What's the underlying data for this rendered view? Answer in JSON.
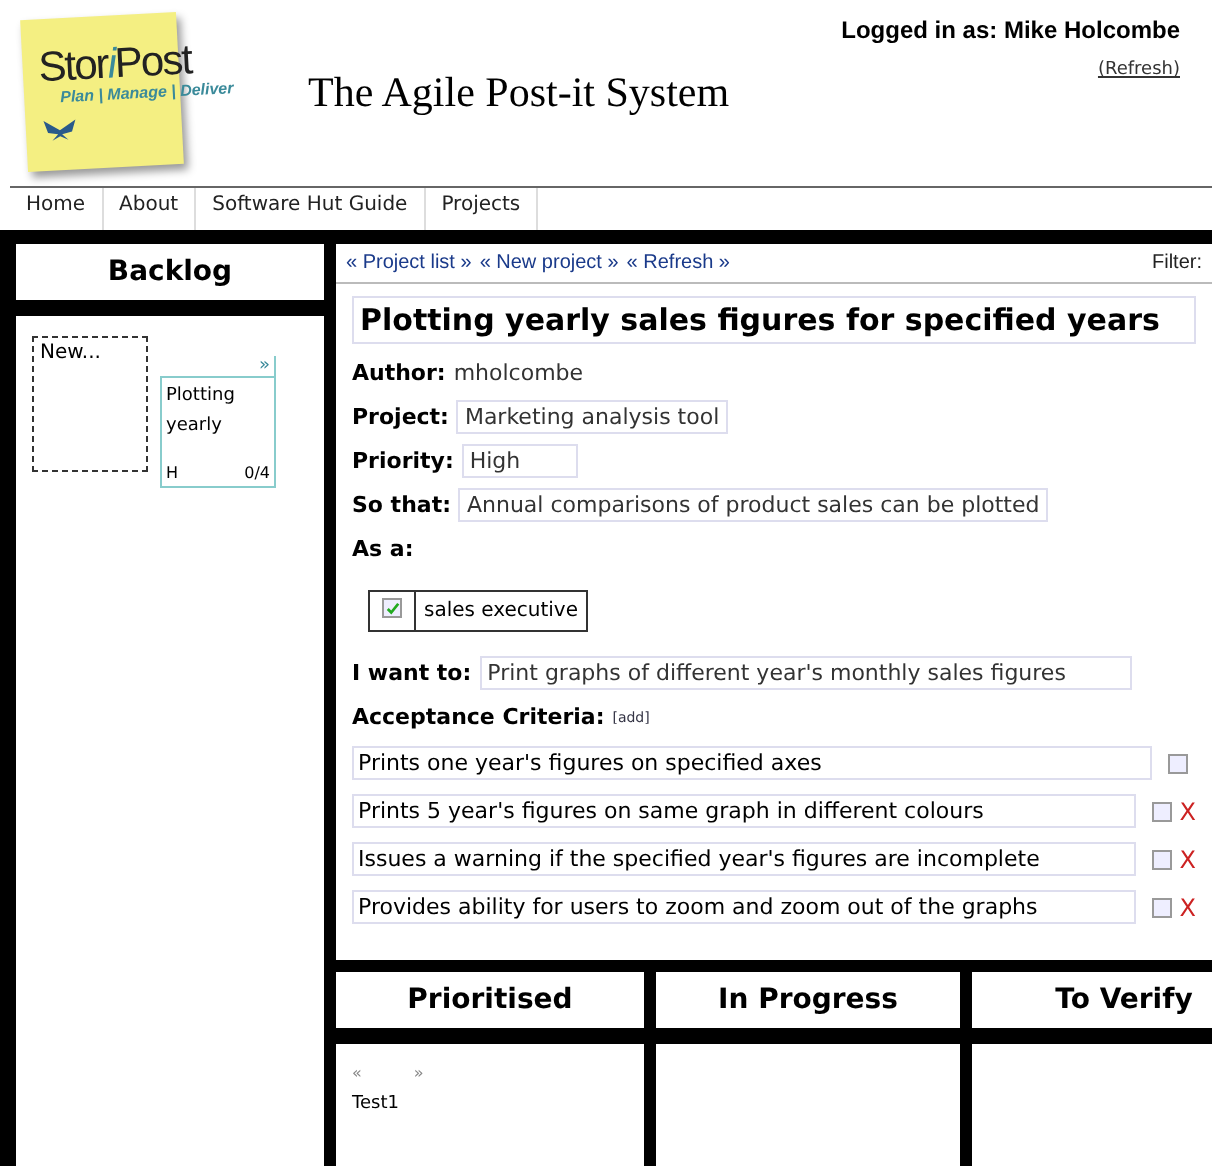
{
  "logo": {
    "parts": [
      "Stor",
      "i",
      "Post"
    ],
    "tagline": "Plan | Manage | Deliver"
  },
  "site_title": "The Agile Post-it System",
  "login": {
    "text": "Logged in as: Mike Holcombe",
    "refresh": "(Refresh)"
  },
  "nav": [
    "Home",
    "About",
    "Software Hut Guide",
    "Projects"
  ],
  "backlog": {
    "title": "Backlog",
    "new_card": "New...",
    "cards": [
      {
        "arrow": "»",
        "title": "Plotting yearly",
        "priority": "H",
        "progress": "0/4"
      }
    ]
  },
  "toolbar": {
    "links": [
      "« Project list »",
      "« New project »",
      "« Refresh »"
    ],
    "filter": "Filter:"
  },
  "story": {
    "title": "Plotting yearly sales figures for specified years",
    "fields": [
      {
        "label": "Author:",
        "value": "mholcombe",
        "kind": "text"
      },
      {
        "label": "Project:",
        "value": "Marketing analysis tool",
        "kind": "field"
      },
      {
        "label": "Priority:",
        "value": "High",
        "kind": "field"
      },
      {
        "label": "So that:",
        "value": "Annual comparisons of product sales can be plotted",
        "kind": "field"
      }
    ],
    "as_a": {
      "label": "As a:",
      "roles": [
        {
          "name": "sales executive",
          "checked": true
        }
      ]
    },
    "i_want_to": {
      "label": "I want to:",
      "value": "Print graphs of different year's monthly sales figures"
    },
    "criteria": {
      "label": "Acceptance Criteria:",
      "add": "[add]",
      "items": [
        {
          "text": "Prints one year's figures on specified axes",
          "checked": false
        },
        {
          "text": "Prints 5 year's figures on same graph in different colours",
          "checked": false,
          "delete": "X"
        },
        {
          "text": "Issues a warning if the specified year's figures are incomplete",
          "checked": false,
          "delete": "X"
        },
        {
          "text": "Provides ability for users to zoom and zoom out of the graphs",
          "checked": false,
          "delete": "X"
        }
      ]
    }
  },
  "columns": [
    {
      "title": "Prioritised",
      "prev": "«",
      "next": "»",
      "cards": [
        "Test1"
      ]
    },
    {
      "title": "In Progress"
    },
    {
      "title": "To Verify"
    }
  ]
}
